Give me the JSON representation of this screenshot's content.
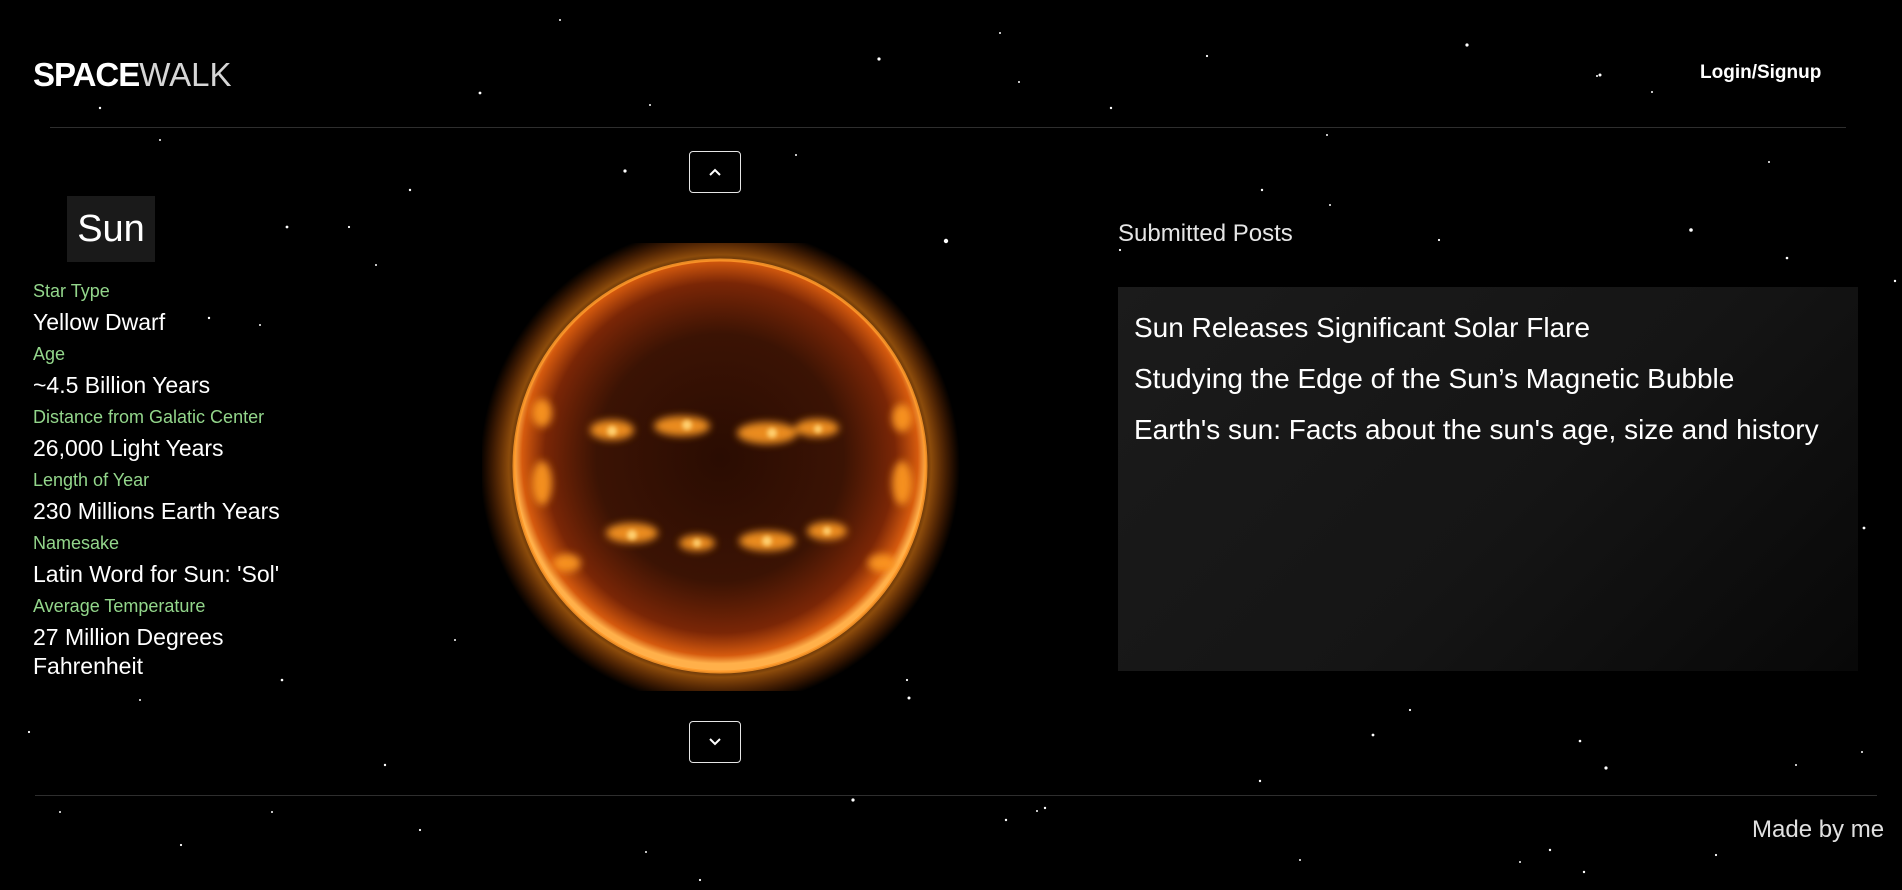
{
  "header": {
    "logo_bold": "SPACE",
    "logo_thin": "WALK",
    "login_label": "Login/Signup"
  },
  "nav": {
    "up_icon": "chevron-up-icon",
    "down_icon": "chevron-down-icon"
  },
  "body": {
    "name": "Sun",
    "facts": [
      {
        "label": "Star Type",
        "value": "Yellow Dwarf"
      },
      {
        "label": "Age",
        "value": "~4.5 Billion Years"
      },
      {
        "label": "Distance from Galatic Center",
        "value": "26,000 Light Years"
      },
      {
        "label": "Length of Year",
        "value": "230 Millions Earth Years"
      },
      {
        "label": "Namesake",
        "value": "Latin Word for Sun: 'Sol'"
      },
      {
        "label": "Average Temperature",
        "value": "27 Million Degrees Fahrenheit"
      }
    ]
  },
  "posts": {
    "heading": "Submitted Posts",
    "items": [
      "Sun Releases Significant Solar Flare",
      "Studying the Edge of the Sun’s Magnetic Bubble",
      "Earth's sun: Facts about the sun's age, size and history"
    ]
  },
  "footer": {
    "text": "Made by me"
  },
  "colors": {
    "background": "#000000",
    "fact_label": "#93d68b",
    "panel": "#1b1b1b",
    "sun_core": "#ff9a1f"
  }
}
